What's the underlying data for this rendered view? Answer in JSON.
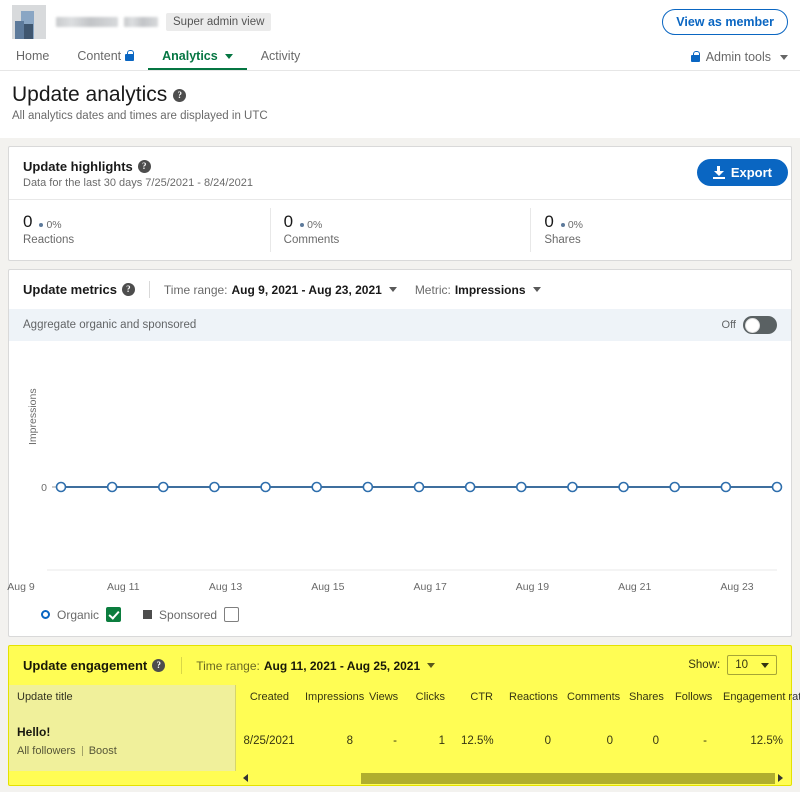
{
  "topbar": {
    "org_logo_name": "company-logo",
    "super_admin_badge": "Super admin view",
    "view_as_member": "View as member"
  },
  "nav": {
    "tabs": [
      {
        "label": "Home",
        "active": false,
        "locked": false
      },
      {
        "label": "Content",
        "active": false,
        "locked": true
      },
      {
        "label": "Analytics",
        "active": true,
        "locked": false,
        "caret": true
      },
      {
        "label": "Activity",
        "active": false,
        "locked": false
      }
    ],
    "admin_tools": "Admin tools"
  },
  "page": {
    "title": "Update analytics",
    "subtitle": "All analytics dates and times are displayed in UTC",
    "export_label": "Export"
  },
  "highlights": {
    "title": "Update highlights",
    "subtitle": "Data for the last 30 days 7/25/2021 - 8/24/2021",
    "stats": [
      {
        "value": "0",
        "delta": "0%",
        "label": "Reactions"
      },
      {
        "value": "0",
        "delta": "0%",
        "label": "Comments"
      },
      {
        "value": "0",
        "delta": "0%",
        "label": "Shares"
      }
    ]
  },
  "metrics": {
    "title": "Update metrics",
    "time_range_label": "Time range:",
    "time_range_value": "Aug 9, 2021 - Aug 23, 2021",
    "metric_label": "Metric:",
    "metric_value": "Impressions",
    "aggregate_label": "Aggregate organic and sponsored",
    "toggle_state": "Off",
    "legend": [
      {
        "label": "Organic",
        "marker": "circle",
        "checked": true,
        "color": "#0a66c2"
      },
      {
        "label": "Sponsored",
        "marker": "square",
        "checked": false,
        "color": "#4d4d4d"
      }
    ]
  },
  "chart_data": {
    "type": "line",
    "title": "Update metrics",
    "xlabel": "",
    "ylabel": "Impressions",
    "ylim": [
      0,
      1
    ],
    "yticks": [
      "0"
    ],
    "grid": false,
    "legend_position": "bottom-left",
    "x": [
      "Aug 9",
      "Aug 10",
      "Aug 11",
      "Aug 12",
      "Aug 13",
      "Aug 14",
      "Aug 15",
      "Aug 16",
      "Aug 17",
      "Aug 18",
      "Aug 19",
      "Aug 20",
      "Aug 21",
      "Aug 22",
      "Aug 23"
    ],
    "xtick_labels": [
      "Aug 9",
      "Aug 11",
      "Aug 13",
      "Aug 15",
      "Aug 17",
      "Aug 19",
      "Aug 21",
      "Aug 23"
    ],
    "series": [
      {
        "name": "Organic",
        "color": "#3f6f9e",
        "marker": "circle-open",
        "values": [
          0,
          0,
          0,
          0,
          0,
          0,
          0,
          0,
          0,
          0,
          0,
          0,
          0,
          0,
          0
        ]
      }
    ]
  },
  "engagement": {
    "title": "Update engagement",
    "time_range_label": "Time range:",
    "time_range_value": "Aug 11, 2021 - Aug 25, 2021",
    "show_label": "Show:",
    "show_value": "10",
    "columns": [
      "Update title",
      "Created",
      "Impressions",
      "Views",
      "Clicks",
      "CTR",
      "Reactions",
      "Comments",
      "Shares",
      "Follows",
      "Engagement rate"
    ],
    "rows": [
      {
        "title": "Hello!",
        "audience": "All followers",
        "boost": "Boost",
        "created": "8/25/2021",
        "impressions": "8",
        "views": "-",
        "clicks": "1",
        "ctr": "12.5%",
        "reactions": "0",
        "comments": "0",
        "shares": "0",
        "follows": "-",
        "engagement_rate": "12.5%"
      }
    ]
  },
  "colors": {
    "accent": "#0a66c2",
    "active_tab": "#057642",
    "highlight": "#fffd54",
    "checkbox_checked": "#0b7d3e",
    "scrollbar_thumb": "#b0ae2e"
  }
}
